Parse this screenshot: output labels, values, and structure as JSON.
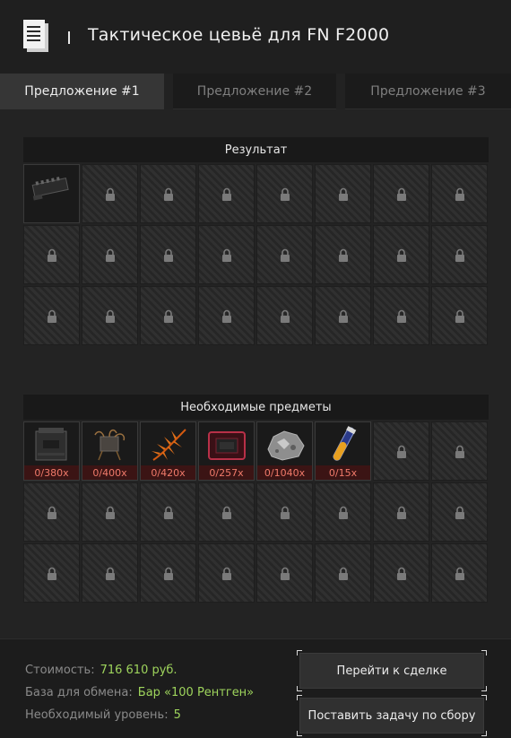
{
  "header": {
    "title": "Тактическое цевьё для FN F2000",
    "icon": "document-icon"
  },
  "tabs": [
    {
      "label": "Предложение #1",
      "active": true
    },
    {
      "label": "Предложение #2",
      "active": false
    },
    {
      "label": "Предложение #3",
      "active": false
    }
  ],
  "result": {
    "header": "Результат",
    "item_icon": "tactical-handguard-icon",
    "locked_icon": "lock-icon"
  },
  "required": {
    "header": "Необходимые предметы",
    "items": [
      {
        "icon": "ammo-box-icon",
        "qty": "0/380x"
      },
      {
        "icon": "wire-device-icon",
        "qty": "0/400x"
      },
      {
        "icon": "orange-fern-icon",
        "qty": "0/420x"
      },
      {
        "icon": "red-case-icon",
        "qty": "0/257x"
      },
      {
        "icon": "ore-rock-icon",
        "qty": "0/1040x"
      },
      {
        "icon": "test-tube-icon",
        "qty": "0/15x"
      }
    ]
  },
  "footer": {
    "cost_label": "Стоимость:",
    "cost_value": "716 610 руб.",
    "base_label": "База для обмена:",
    "base_value": "Бар «100 Рентген»",
    "level_label": "Необходимый уровень:",
    "level_value": "5",
    "goto_button": "Перейти к сделке",
    "task_button": "Поставить задачу по сбору"
  },
  "colors": {
    "accent_green": "#9ed45c",
    "qty_red": "#f07a6a"
  }
}
